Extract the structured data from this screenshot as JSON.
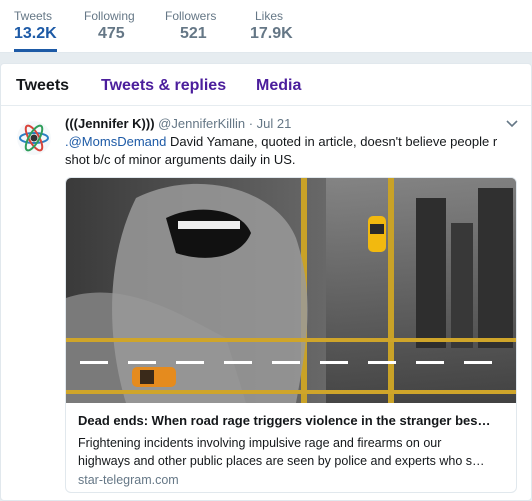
{
  "profile_stats": [
    {
      "label": "Tweets",
      "value": "13.2K"
    },
    {
      "label": "Following",
      "value": "475"
    },
    {
      "label": "Followers",
      "value": "521"
    },
    {
      "label": "Likes",
      "value": "17.9K"
    }
  ],
  "tabs": [
    {
      "label": "Tweets"
    },
    {
      "label": "Tweets & replies"
    },
    {
      "label": "Media"
    }
  ],
  "tweet": {
    "author_name": "(((Jennifer K)))",
    "author_handle": "@JenniferKillin",
    "separator": "·",
    "time": "Jul 21",
    "mention": ".@MomsDemand",
    "text_line1": " David Yamane, quoted in article, doesn't believe people r",
    "text_line2": "shot b/c of minor arguments daily in US.",
    "card": {
      "title": "Dead ends: When road rage triggers violence in the stranger bes…",
      "desc_line1": "Frightening incidents involving impulsive rage and firearms on our",
      "desc_line2": "highways and other public places are seen by police and experts who s…",
      "domain": "star-telegram.com"
    }
  },
  "colors": {
    "accent": "#1d5aa6",
    "tab_link": "#4b1e9c",
    "muted": "#657786"
  },
  "icons": [
    "atom-avatar-icon",
    "chevron-down-icon"
  ]
}
